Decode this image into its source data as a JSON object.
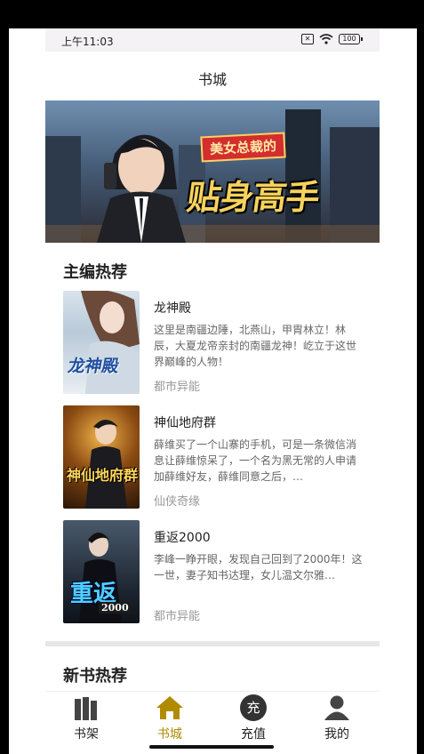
{
  "status_bar": {
    "time": "上午11:03",
    "sim": "✕",
    "battery": "100"
  },
  "header": {
    "title": "书城"
  },
  "banner": {
    "subtitle": "美女总裁的",
    "title": "贴身高手"
  },
  "featured": {
    "title": "主编热荐",
    "books": [
      {
        "title": "龙神殿",
        "description": "这里是南疆边陲，北燕山，甲胄林立！林辰，大夏龙帝亲封的南疆龙神！屹立于这世界巅峰的人物！",
        "tag": "都市异能",
        "cover_text": "龙神殿"
      },
      {
        "title": "神仙地府群",
        "description": "薛维买了一个山寨的手机，可是一条微信消息让薛维惊呆了，一个名为黑无常的人申请加薛维好友，薛维同意之后，…",
        "tag": "仙侠奇缘",
        "cover_text": "神仙地府群"
      },
      {
        "title": "重返2000",
        "description": "李峰一睁开眼，发现自己回到了2000年！这一世，妻子知书达理，女儿温文尔雅…",
        "tag": "都市异能",
        "cover_text": "重返",
        "cover_sub": "2000"
      }
    ]
  },
  "new_books": {
    "title": "新书热荐"
  },
  "tabs": [
    {
      "label": "书架",
      "icon": "bookshelf-icon",
      "active": false
    },
    {
      "label": "书城",
      "icon": "home-icon",
      "active": true
    },
    {
      "label": "充值",
      "icon": "recharge-icon",
      "glyph": "充",
      "active": false
    },
    {
      "label": "我的",
      "icon": "user-icon",
      "active": false
    }
  ],
  "colors": {
    "active_tab": "#b08b00",
    "tag": "#999999",
    "desc": "#666666"
  }
}
